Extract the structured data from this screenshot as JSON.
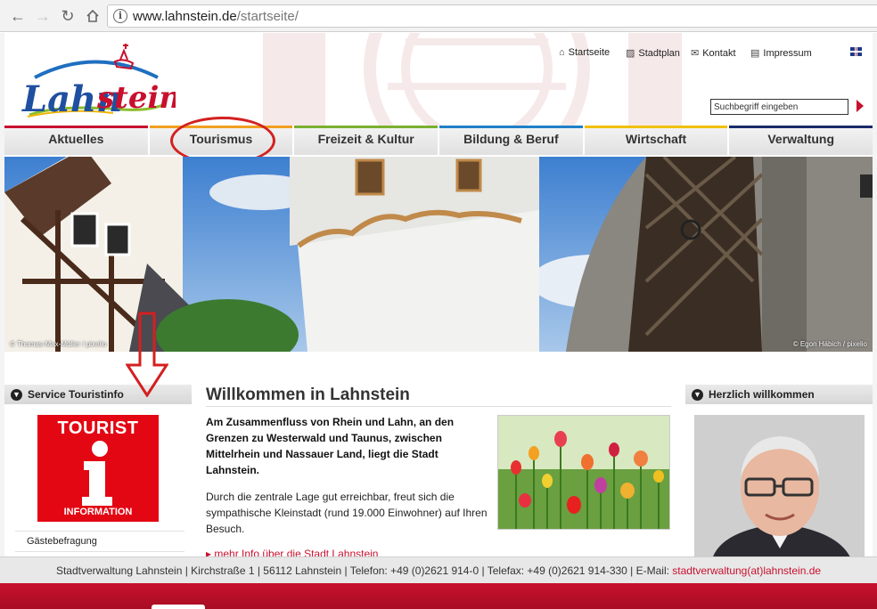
{
  "browser": {
    "url_host": "www.lahnstein.de",
    "url_path": "/startseite/"
  },
  "header": {
    "logo_text": "Lahnstein",
    "top_links": [
      {
        "label": "Startseite",
        "icon": "home-icon"
      },
      {
        "label": "Stadtplan",
        "icon": "map-icon"
      },
      {
        "label": "Kontakt",
        "icon": "mail-icon"
      },
      {
        "label": "Impressum",
        "icon": "document-icon"
      }
    ],
    "language_flag": "uk-flag-icon",
    "search_placeholder": "Suchbegriff eingeben"
  },
  "nav": {
    "items": [
      {
        "label": "Aktuelles",
        "color": "#c8102e"
      },
      {
        "label": "Tourismus",
        "color": "#f0a020"
      },
      {
        "label": "Freizeit & Kultur",
        "color": "#7ab030"
      },
      {
        "label": "Bildung & Beruf",
        "color": "#2080c8"
      },
      {
        "label": "Wirtschaft",
        "color": "#f0c000"
      },
      {
        "label": "Verwaltung",
        "color": "#1a2a6a"
      }
    ]
  },
  "hero": {
    "credit_left": "© Thomas-Max-Müller / pixelio",
    "credit_right": "© Egon Häbich / pixelio"
  },
  "left": {
    "heading": "Service Touristinfo",
    "badge_top": "TOURIST",
    "badge_bottom": "INFORMATION",
    "links": [
      "Gästebefragung"
    ]
  },
  "main": {
    "title": "Willkommen in Lahnstein",
    "lead": "Am Zusammenfluss von Rhein und Lahn, an den Grenzen zu Westerwald und Taunus, zwischen Mittelrhein und Nassauer Land, liegt die Stadt Lahnstein.",
    "paragraph": "Durch die zentrale Lage gut erreichbar, freut sich die sympathische Kleinstadt (rund 19.000 Einwohner) auf Ihren Besuch.",
    "more_link": "mehr Info über die Stadt Lahnstein"
  },
  "right": {
    "heading": "Herzlich willkommen"
  },
  "footer": {
    "text": "Stadtverwaltung Lahnstein | Kirchstraße 1 | 56112 Lahnstein | Telefon: +49 (0)2621 914-0 | Telefax: +49 (0)2621 914-330 | E-Mail: ",
    "email": "stadtverwaltung(at)lahnstein.de"
  },
  "colors": {
    "brand_red": "#c8102e",
    "annotation_red": "#d42020"
  }
}
